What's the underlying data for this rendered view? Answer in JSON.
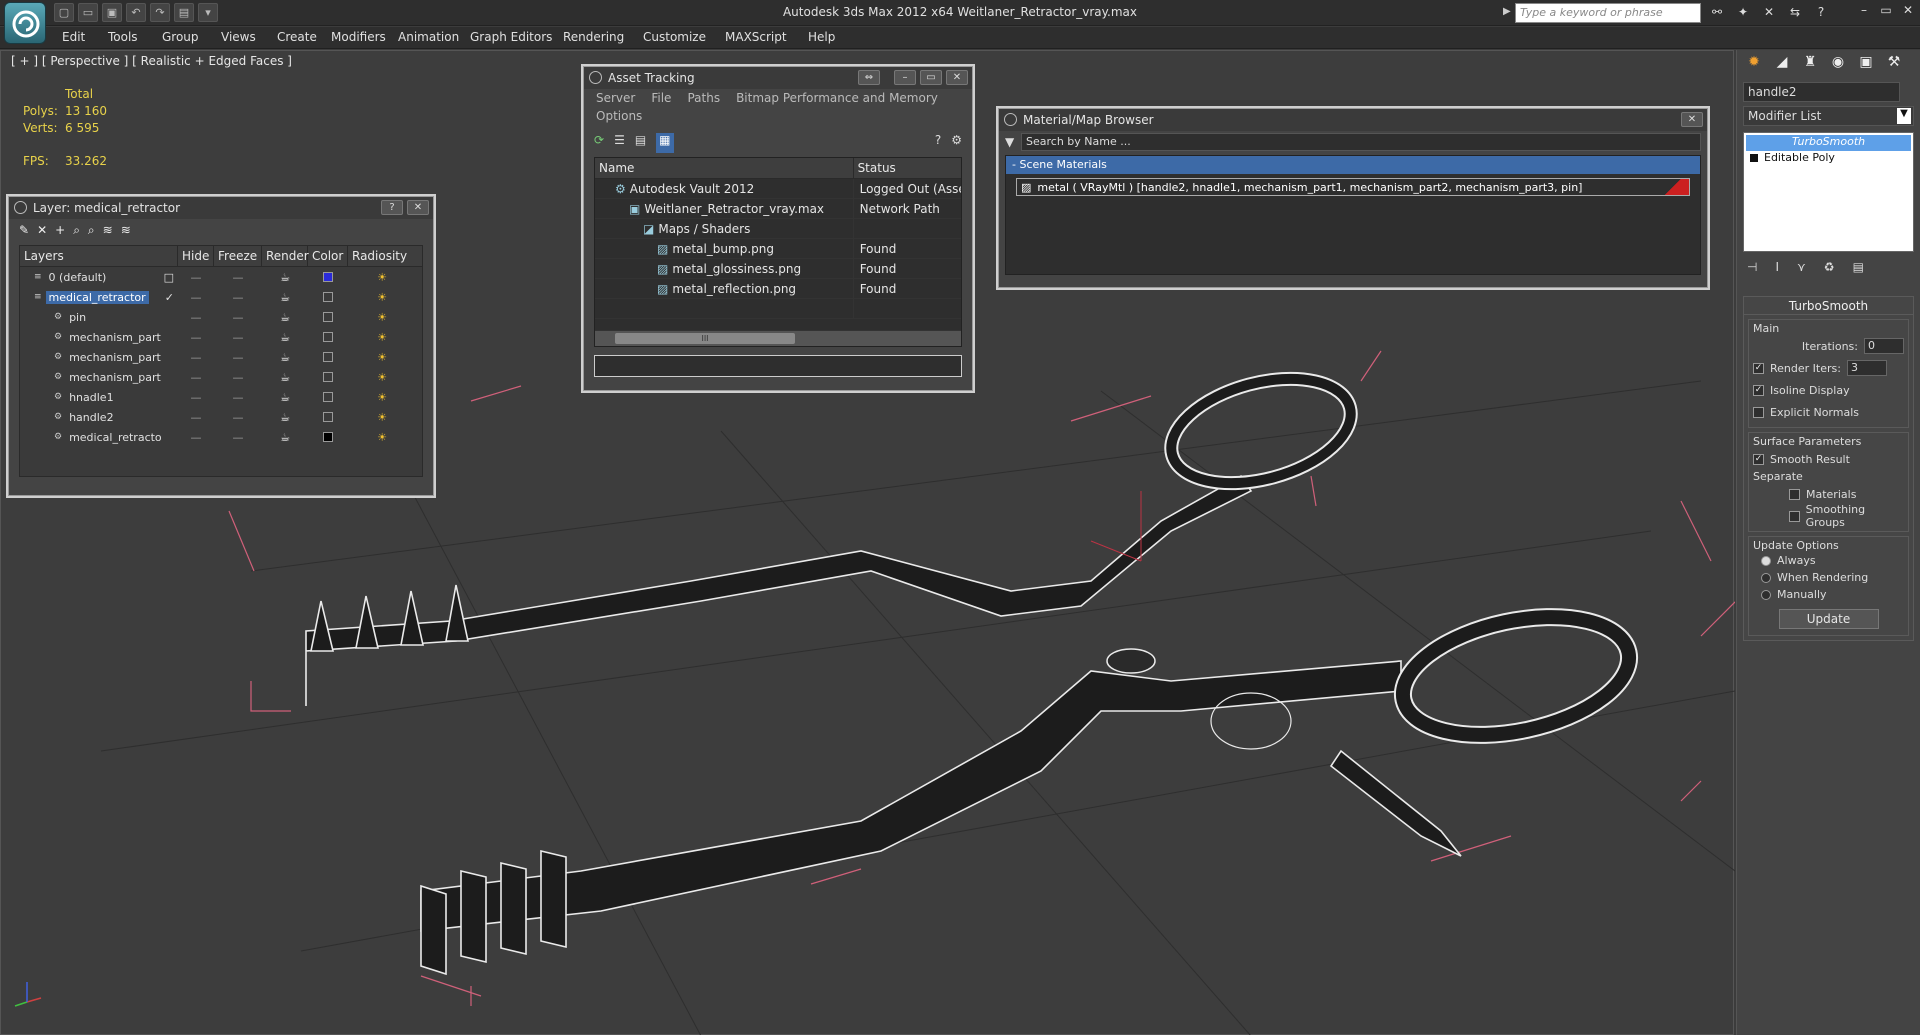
{
  "window": {
    "title": "Autodesk 3ds Max  2012 x64     Weitlaner_Retractor_vray.max",
    "search_placeholder": "Type a keyword or phrase"
  },
  "menu": [
    "Edit",
    "Tools",
    "Group",
    "Views",
    "Create",
    "Modifiers",
    "Animation",
    "Graph Editors",
    "Rendering",
    "Customize",
    "MAXScript",
    "Help"
  ],
  "viewport": {
    "label": "[ + ] [ Perspective ] [ Realistic + Edged Faces ]",
    "stats": {
      "header": "Total",
      "polys_label": "Polys:",
      "polys": "13 160",
      "verts_label": "Verts:",
      "verts": "6 595",
      "fps_label": "FPS:",
      "fps": "33.262"
    }
  },
  "layer_dialog": {
    "title": "Layer: medical_retractor",
    "columns": [
      "Layers",
      "Hide",
      "Freeze",
      "Render",
      "Color",
      "Radiosity"
    ],
    "rows": [
      {
        "name": "0 (default)",
        "color": "#2a2ad8",
        "selected": false,
        "check": "□"
      },
      {
        "name": "medical_retractor",
        "color": "#3a3a3a",
        "selected": true,
        "check": "✓"
      },
      {
        "name": "pin",
        "color": "#3a3a3a",
        "selected": false,
        "check": ""
      },
      {
        "name": "mechanism_part",
        "color": "#3a3a3a",
        "selected": false,
        "check": ""
      },
      {
        "name": "mechanism_part",
        "color": "#3a3a3a",
        "selected": false,
        "check": ""
      },
      {
        "name": "mechanism_part",
        "color": "#3a3a3a",
        "selected": false,
        "check": ""
      },
      {
        "name": "hnadle1",
        "color": "#3a3a3a",
        "selected": false,
        "check": ""
      },
      {
        "name": "handle2",
        "color": "#3a3a3a",
        "selected": false,
        "check": ""
      },
      {
        "name": "medical_retracto",
        "color": "#000000",
        "selected": false,
        "check": ""
      }
    ]
  },
  "asset_dialog": {
    "title": "Asset Tracking",
    "menu": [
      "Server",
      "File",
      "Paths",
      "Bitmap Performance and Memory"
    ],
    "menu2": "Options",
    "col_name": "Name",
    "col_status": "Status",
    "scroll_thumb": "III",
    "rows": [
      {
        "name": "Autodesk Vault 2012",
        "status": "Logged Out (Asset"
      },
      {
        "name": "Weitlaner_Retractor_vray.max",
        "status": "Network Path"
      },
      {
        "name": "Maps / Shaders",
        "status": ""
      },
      {
        "name": "metal_bump.png",
        "status": "Found"
      },
      {
        "name": "metal_glossiness.png",
        "status": "Found"
      },
      {
        "name": "metal_reflection.png",
        "status": "Found"
      },
      {
        "name": "",
        "status": ""
      }
    ]
  },
  "material_dialog": {
    "title": "Material/Map Browser",
    "search": "Search by Name ...",
    "group": "- Scene Materials",
    "item": "metal  ( VRayMtl )  [handle2, hnadle1, mechanism_part1, mechanism_part2, mechanism_part3, pin]"
  },
  "command_panel": {
    "object_name": "handle2",
    "modifier_list": "Modifier List",
    "stack": [
      "TurboSmooth",
      "Editable Poly"
    ],
    "rollout": "TurboSmooth",
    "main": "Main",
    "iterations_label": "Iterations:",
    "iterations": "0",
    "render_iters_label": "Render Iters:",
    "render_iters": "3",
    "isoline": "Isoline Display",
    "explicit": "Explicit Normals",
    "surface": "Surface Parameters",
    "smooth": "Smooth Result",
    "separate": "Separate",
    "materials": "Materials",
    "smoothing": "Smoothing Groups",
    "update_options": "Update Options",
    "always": "Always",
    "when_rendering": "When Rendering",
    "manually": "Manually",
    "update": "Update"
  }
}
